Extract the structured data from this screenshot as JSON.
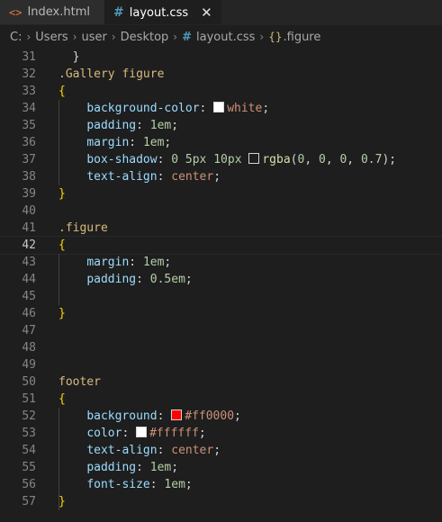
{
  "tabs": [
    {
      "label": "Index.html",
      "icon": "html-icon",
      "modified": true
    },
    {
      "label": "layout.css",
      "icon": "css-icon",
      "active": true
    }
  ],
  "breadcrumb": {
    "drive": "C:",
    "folders": [
      "Users",
      "user",
      "Desktop"
    ],
    "file": "layout.css",
    "symbol": ".figure"
  },
  "editor": {
    "current_line": "42",
    "lines": [
      {
        "n": "31"
      },
      {
        "n": "32"
      },
      {
        "n": "33"
      },
      {
        "n": "34"
      },
      {
        "n": "35"
      },
      {
        "n": "36"
      },
      {
        "n": "37"
      },
      {
        "n": "38"
      },
      {
        "n": "39"
      },
      {
        "n": "40"
      },
      {
        "n": "41"
      },
      {
        "n": "42"
      },
      {
        "n": "43"
      },
      {
        "n": "44"
      },
      {
        "n": "45"
      },
      {
        "n": "46"
      },
      {
        "n": "47"
      },
      {
        "n": "48"
      },
      {
        "n": "49"
      },
      {
        "n": "50"
      },
      {
        "n": "51"
      },
      {
        "n": "52"
      },
      {
        "n": "53"
      },
      {
        "n": "54"
      },
      {
        "n": "55"
      },
      {
        "n": "56"
      },
      {
        "n": "57"
      }
    ],
    "code": {
      "gallery_selector": ".Gallery figure",
      "open": "{",
      "close": "}",
      "bg_color_prop": "background-color",
      "white": "white",
      "padding_prop": "padding",
      "one_em": "1em",
      "margin_prop": "margin",
      "box_shadow_prop": "box-shadow",
      "shadow_0": "0",
      "shadow_5px": "5px",
      "shadow_10px": "10px",
      "rgba_fn": "rgba",
      "rgba_args": [
        "0",
        "0",
        "0",
        "0.7"
      ],
      "text_align_prop": "text-align",
      "center": "center",
      "figure_selector": ".figure",
      "half_em": "0.5em",
      "footer_selector": "footer",
      "background_prop": "background",
      "red_hex": "#ff0000",
      "color_prop": "color",
      "white_hex": "#ffffff",
      "font_size_prop": "font-size"
    }
  },
  "colors": {
    "red": "#ff0000",
    "white": "#ffffff",
    "shadow": "#000000"
  }
}
